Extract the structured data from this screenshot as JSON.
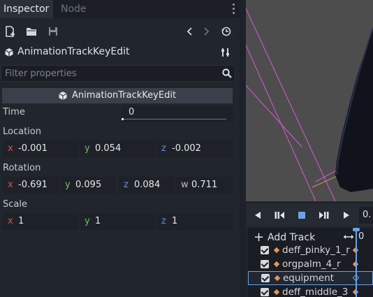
{
  "tabs": [
    {
      "label": "Inspector",
      "active": true
    },
    {
      "label": "Node",
      "active": false
    }
  ],
  "toolbar": {
    "icons": [
      "new-resource-icon",
      "open-folder-icon",
      "save-icon",
      "history-back-icon",
      "history-forward-icon",
      "object-history-icon"
    ]
  },
  "object": {
    "name": "AnimationTrackKeyEdit",
    "icon": "cube-icon",
    "tools_icon": "object-tools-icon"
  },
  "filter": {
    "placeholder": "Filter properties",
    "value": ""
  },
  "section": {
    "title": "AnimationTrackKeyEdit"
  },
  "properties": {
    "time": {
      "label": "Time",
      "value": "0"
    },
    "location": {
      "label": "Location",
      "x": "-0.001",
      "y": "0.054",
      "z": "-0.002"
    },
    "rotation": {
      "label": "Rotation",
      "x": "-0.691",
      "y": "0.095",
      "z": "0.084",
      "w": "0.711"
    },
    "scale": {
      "label": "Scale",
      "x": "1",
      "y": "1",
      "z": "1"
    }
  },
  "axes": {
    "x": "x",
    "y": "y",
    "z": "z",
    "w": "w"
  },
  "animation": {
    "add_track_label": "Add Track",
    "time_value": "0.",
    "zoom_value": "0",
    "tracks": [
      {
        "name": "deff_pinky_1_r",
        "selected": false
      },
      {
        "name": "orgpalm_4_r",
        "selected": false
      },
      {
        "name": "equipment",
        "selected": true
      },
      {
        "name": "deff_middle_3",
        "selected": false
      }
    ]
  },
  "colors": {
    "axis_x": "#d9534f",
    "axis_y": "#6fbf5a",
    "axis_z": "#5f8de0",
    "accent": "#6aa4e6",
    "keyframe": "#e8955a"
  }
}
